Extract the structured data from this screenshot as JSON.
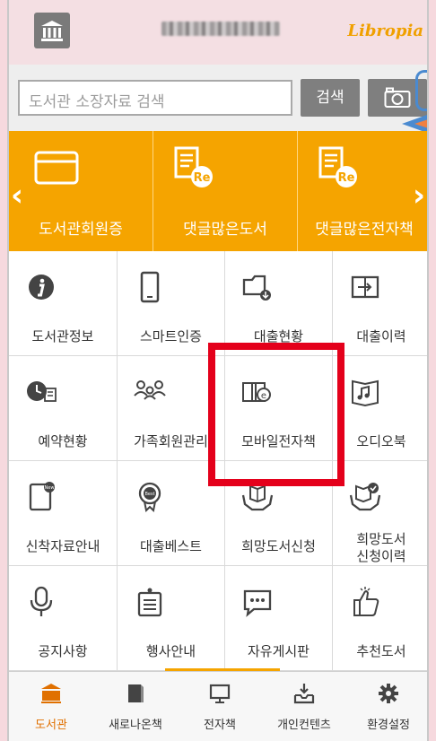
{
  "header": {
    "home_icon": "library-building-icon",
    "brand": "Libropia"
  },
  "search": {
    "placeholder": "도서관 소장자료 검색",
    "button_label": "검색",
    "camera_icon": "camera-icon"
  },
  "banner": {
    "items": [
      {
        "label": "도서관회원증",
        "icon": "card-icon"
      },
      {
        "label": "댓글많은도서",
        "icon": "book-reply-icon"
      },
      {
        "label": "댓글많은전자책",
        "icon": "book-reply-icon"
      }
    ],
    "left_arrow": "‹",
    "right_arrow": "›"
  },
  "menu": {
    "items": [
      {
        "label": "도서관정보",
        "icon": "info-icon"
      },
      {
        "label": "스마트인증",
        "icon": "smartphone-icon"
      },
      {
        "label": "대출현황",
        "icon": "folder-download-icon"
      },
      {
        "label": "대출이력",
        "icon": "enter-box-icon"
      },
      {
        "label": "예약현황",
        "icon": "clock-list-icon"
      },
      {
        "label": "가족회원관리",
        "icon": "family-icon"
      },
      {
        "label": "모바일전자책",
        "icon": "ebook-icon"
      },
      {
        "label": "오디오북",
        "icon": "audiobook-icon"
      },
      {
        "label": "신착자료안내",
        "icon": "new-book-icon"
      },
      {
        "label": "대출베스트",
        "icon": "best-badge-icon"
      },
      {
        "label": "희망도서신청",
        "icon": "hands-book-icon"
      },
      {
        "label": "희망도서\n신청이력",
        "icon": "hands-book-check-icon"
      },
      {
        "label": "공지사항",
        "icon": "microphone-icon"
      },
      {
        "label": "행사안내",
        "icon": "notice-board-icon"
      },
      {
        "label": "자유게시판",
        "icon": "chat-bubble-icon"
      },
      {
        "label": "추천도서",
        "icon": "thumbs-up-icon"
      }
    ]
  },
  "tabs": [
    {
      "label": "도서관",
      "icon": "library-icon",
      "active": true
    },
    {
      "label": "새로나온책",
      "icon": "new-book-tab-icon",
      "active": false
    },
    {
      "label": "전자책",
      "icon": "monitor-icon",
      "active": false
    },
    {
      "label": "개인컨텐츠",
      "icon": "inbox-download-icon",
      "active": false
    },
    {
      "label": "환경설정",
      "icon": "gear-icon",
      "active": false
    }
  ],
  "colors": {
    "accent": "#f5a400",
    "highlight": "#e4001b",
    "brand": "#f0a000"
  }
}
